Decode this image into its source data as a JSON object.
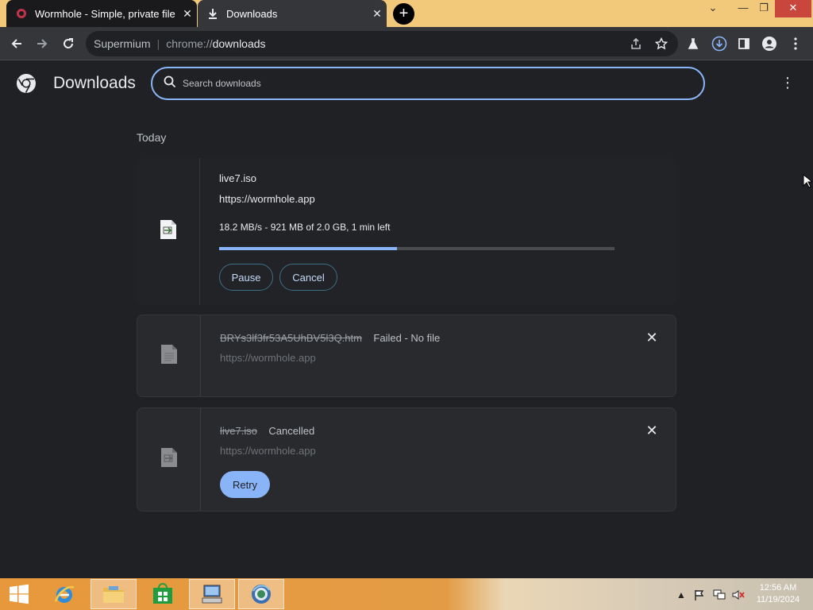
{
  "tabs": [
    {
      "title": "Wormhole - Simple, private file s",
      "close": "✕",
      "favicon": "wormhole-icon"
    },
    {
      "title": "Downloads",
      "close": "✕",
      "favicon": "download-icon"
    }
  ],
  "new_tab": "+",
  "window": {
    "minimize": "—",
    "restore": "❐",
    "close": "✕"
  },
  "omnibox": {
    "brand": "Supermium",
    "separator": "|",
    "scheme": "chrome://",
    "host": "downloads"
  },
  "downloads_page": {
    "title": "Downloads",
    "search_placeholder": "Search downloads",
    "section_date": "Today",
    "items": [
      {
        "filename": "live7.iso",
        "url": "https://wormhole.app",
        "progress_text": "18.2 MB/s - 921 MB of 2.0 GB, 1 min left",
        "progress": 0.45,
        "buttons": {
          "pause": "Pause",
          "cancel": "Cancel"
        }
      },
      {
        "filename": "BRYs3lf3fr53A5UhBV5l3Q.htm",
        "status": "Failed - No file",
        "url": "https://wormhole.app",
        "remove": "✕"
      },
      {
        "filename": "live7.iso",
        "status": "Cancelled",
        "url": "https://wormhole.app",
        "remove": "✕",
        "buttons": {
          "retry": "Retry"
        }
      }
    ]
  },
  "taskbar": {
    "time": "12:56 AM",
    "date": "11/19/2024",
    "items": [
      "start-icon",
      "internet-explorer-icon",
      "file-explorer-icon",
      "store-icon",
      "computer-icon",
      "browser-icon"
    ]
  },
  "colors": {
    "accent": "#8ab4f8",
    "background": "#202124",
    "card": "#292a2d",
    "titlebar": "#f2c87a"
  }
}
